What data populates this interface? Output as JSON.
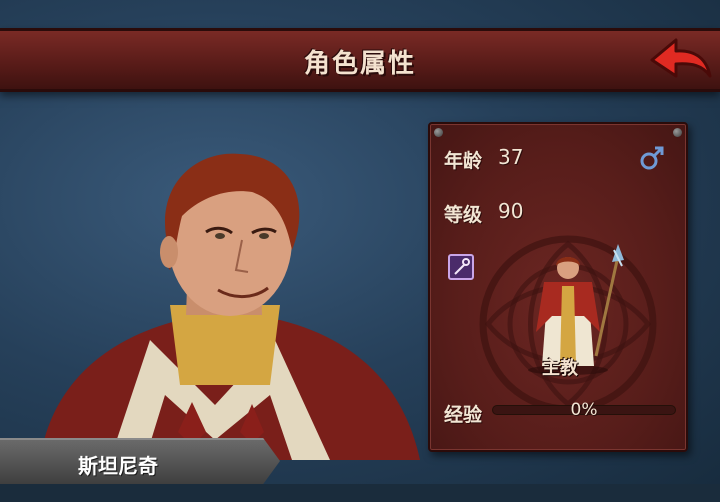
{
  "header": {
    "title": "角色属性"
  },
  "character": {
    "name": "斯坦尼奇",
    "class_name": "主教",
    "gender_icon": "male-icon",
    "weapon_icon": "staff-icon"
  },
  "stats": {
    "age_label": "年龄",
    "age_value": "37",
    "level_label": "等级",
    "level_value": "90",
    "exp_label": "经验",
    "exp_value": "0%",
    "exp_progress": 0
  },
  "colors": {
    "panel": "#571d1a",
    "banner": "#5a1c19",
    "back_arrow": "#e02a22",
    "gender": "#6f9ad6"
  }
}
